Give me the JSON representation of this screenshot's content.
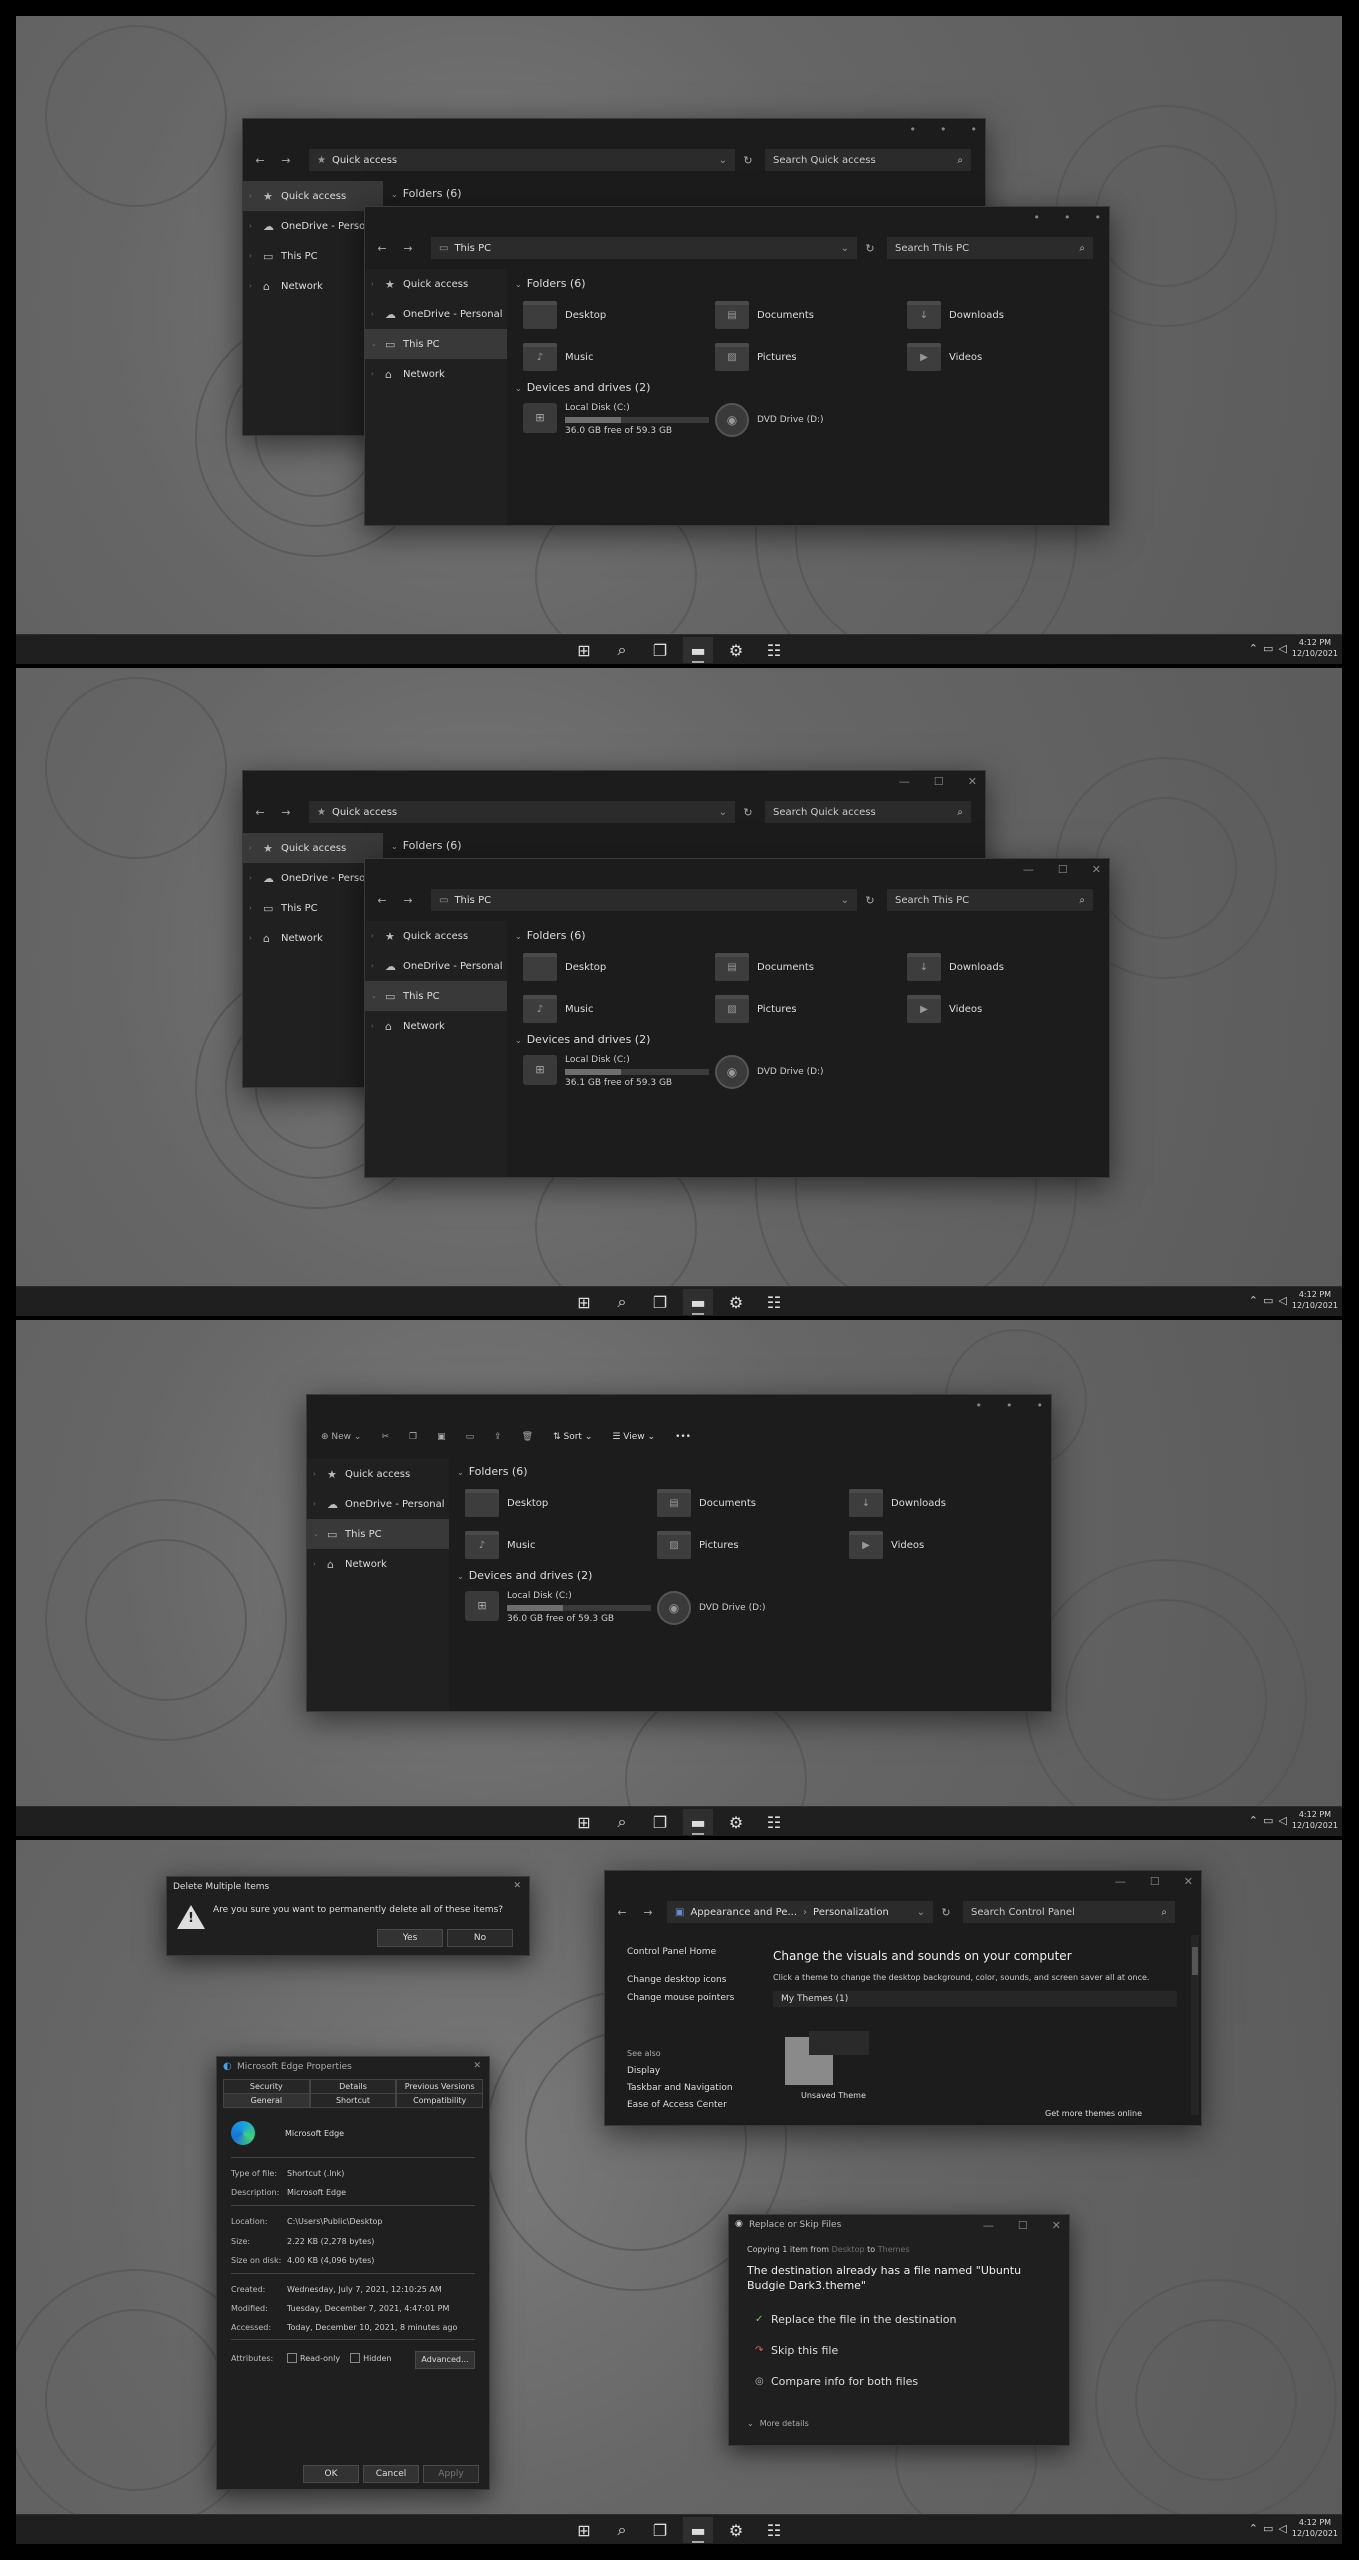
{
  "explorer": {
    "quick_access_crumb": "Quick access",
    "this_pc_crumb": "This PC",
    "search_quick_access": "Search Quick access",
    "search_this_pc": "Search This PC",
    "nav": {
      "quick_access": "Quick access",
      "onedrive": "OneDrive - Personal",
      "this_pc": "This PC",
      "network": "Network"
    },
    "folders_header": "Folders (6)",
    "devices_header": "Devices and drives (2)",
    "folders": [
      "Desktop",
      "Documents",
      "Downloads",
      "Music",
      "Pictures",
      "Videos"
    ],
    "local_disk": "Local Disk (C:)",
    "dvd_drive": "DVD Drive (D:)",
    "free_space_1": "36.0 GB free of 59.3 GB",
    "free_space_2": "36.1 GB free of 59.3 GB",
    "free_space_3": "36.0 GB free of 59.3 GB",
    "disk_used_fraction": 0.39
  },
  "toolbar": {
    "new_label": "New",
    "sort_label": "Sort",
    "view_label": "View",
    "more_label": "•••"
  },
  "taskbar": {
    "time": "4:12 PM",
    "date": "12/10/2021"
  },
  "delete_dialog": {
    "title": "Delete Multiple Items",
    "message": "Are you sure you want to permanently delete all of these items?",
    "yes": "Yes",
    "no": "No"
  },
  "control_panel": {
    "crumb1": "Appearance and Pe...",
    "crumb2": "Personalization",
    "search": "Search Control Panel",
    "home": "Control Panel Home",
    "link1": "Change desktop icons",
    "link2": "Change mouse pointers",
    "see_also": "See also",
    "see1": "Display",
    "see2": "Taskbar and Navigation",
    "see3": "Ease of Access Center",
    "heading": "Change the visuals and sounds on your computer",
    "sub": "Click a theme to change the desktop background, color, sounds, and screen saver all at once.",
    "my_themes": "My Themes (1)",
    "unsaved": "Unsaved Theme",
    "get_more": "Get more themes online"
  },
  "properties": {
    "title": "Microsoft Edge Properties",
    "tabs_row1": [
      "Security",
      "Details",
      "Previous Versions"
    ],
    "tabs_row2": [
      "General",
      "Shortcut",
      "Compatibility"
    ],
    "name": "Microsoft Edge",
    "type_k": "Type of file:",
    "type_v": "Shortcut (.lnk)",
    "desc_k": "Description:",
    "desc_v": "Microsoft Edge",
    "loc_k": "Location:",
    "loc_v": "C:\\Users\\Public\\Desktop",
    "size_k": "Size:",
    "size_v": "2.22 KB (2,278 bytes)",
    "disk_k": "Size on disk:",
    "disk_v": "4.00 KB (4,096 bytes)",
    "created_k": "Created:",
    "created_v": "Wednesday, July 7, 2021, 12:10:25 AM",
    "modified_k": "Modified:",
    "modified_v": "Tuesday, December 7, 2021, 4:47:01 PM",
    "accessed_k": "Accessed:",
    "accessed_v": "Today, December 10, 2021, 8 minutes ago",
    "attr_k": "Attributes:",
    "readonly": "Read-only",
    "hidden": "Hidden",
    "advanced": "Advanced...",
    "ok": "OK",
    "cancel": "Cancel",
    "apply": "Apply"
  },
  "replace_dialog": {
    "title": "Replace or Skip Files",
    "copying_a": "Copying 1 item from",
    "copying_from": "Desktop",
    "copying_to": "to",
    "copying_dest": "Themes",
    "message": "The destination already has a file named \"Ubuntu Budgie Dark3.theme\"",
    "opt1": "Replace the file in the destination",
    "opt2": "Skip this file",
    "opt3": "Compare info for both files",
    "more": "More details"
  }
}
